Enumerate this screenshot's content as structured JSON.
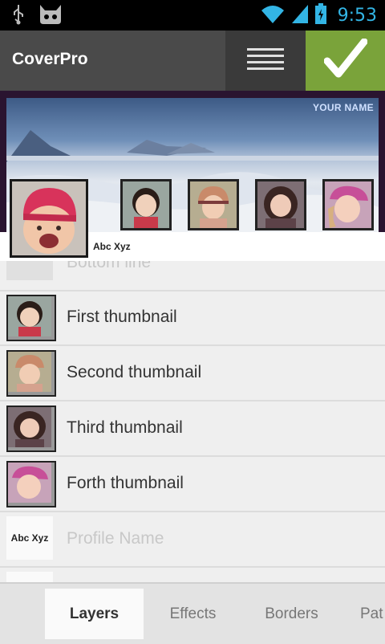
{
  "status_bar": {
    "time": "9:53",
    "left_icons": [
      "usb-icon",
      "android-debug-icon"
    ],
    "right_icons": [
      "wifi-icon",
      "signal-icon",
      "battery-icon"
    ]
  },
  "action_bar": {
    "title": "CoverPro",
    "menu_icon": "menu-icon",
    "confirm_icon": "check-icon",
    "accent": "#7aa33a"
  },
  "cover": {
    "overlay_name": "YOUR NAME",
    "profile_name": "Abc Xyz"
  },
  "layers": [
    {
      "label": "Bottom line",
      "kind": "partial"
    },
    {
      "label": "First thumbnail",
      "kind": "thumb"
    },
    {
      "label": "Second thumbnail",
      "kind": "thumb"
    },
    {
      "label": "Third thumbnail",
      "kind": "thumb"
    },
    {
      "label": "Forth thumbnail",
      "kind": "thumb"
    },
    {
      "label": "Profile Name",
      "kind": "text",
      "preview": "Abc Xyz"
    }
  ],
  "tabs": [
    {
      "label": "Layers",
      "active": true
    },
    {
      "label": "Effects",
      "active": false
    },
    {
      "label": "Borders",
      "active": false
    },
    {
      "label": "Pat",
      "active": false
    }
  ]
}
